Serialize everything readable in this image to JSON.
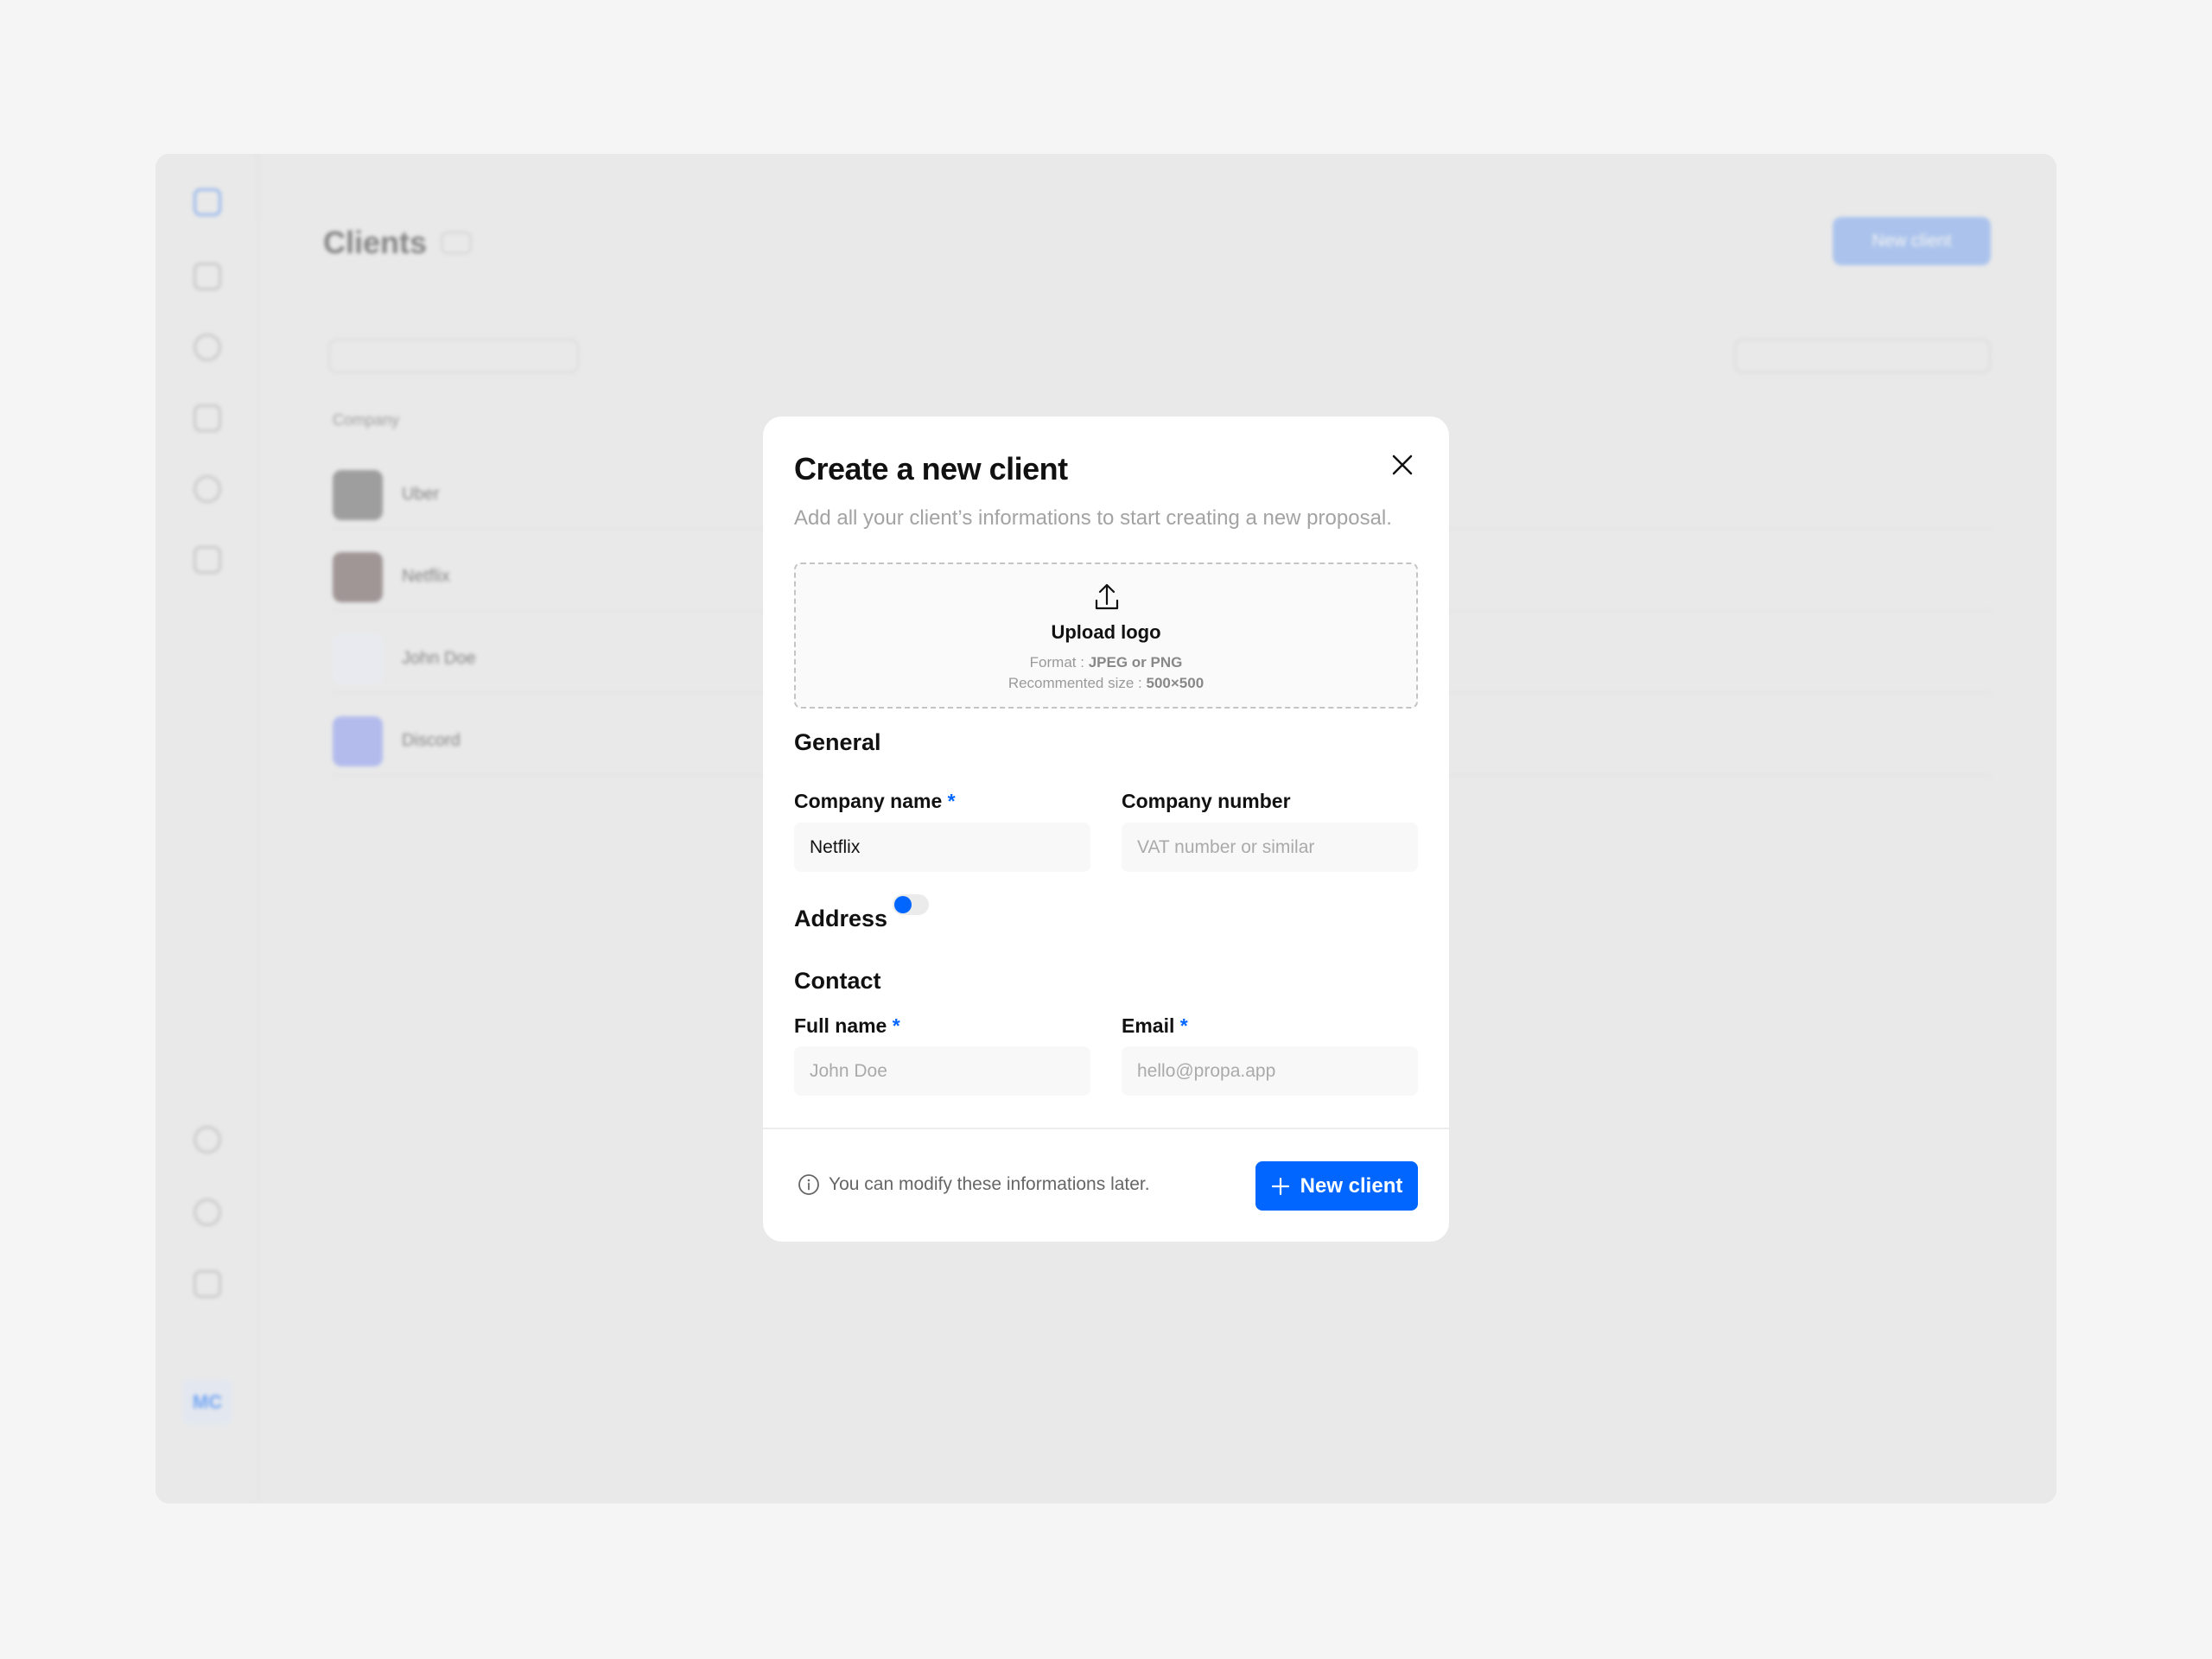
{
  "background": {
    "page_title": "Clients",
    "primary_button": "New client",
    "table_header": "Company",
    "rows": [
      {
        "name": "Uber",
        "avatar_color": "#555555"
      },
      {
        "name": "Netflix",
        "avatar_color": "#5a4545"
      },
      {
        "name": "John Doe",
        "avatar_color": "#e8ecf8"
      },
      {
        "name": "Discord",
        "avatar_color": "#7d8ff0"
      }
    ],
    "user_initials": "MC"
  },
  "modal": {
    "title": "Create a new client",
    "subtitle": "Add all your client’s informations to start creating a new proposal.",
    "upload": {
      "label": "Upload logo",
      "format_prefix": "Format : ",
      "format_value": "JPEG or PNG",
      "size_prefix": "Recommented size : ",
      "size_value": "500×500",
      "icon": "upload-icon"
    },
    "general": {
      "heading": "General",
      "company_name": {
        "label": "Company name",
        "required": "*",
        "value": "Netflix"
      },
      "company_number": {
        "label": "Company number",
        "placeholder": "VAT number or similar"
      }
    },
    "address": {
      "heading": "Address",
      "toggle_on": false
    },
    "contact": {
      "heading": "Contact",
      "full_name": {
        "label": "Full name",
        "required": "*",
        "placeholder": "John Doe"
      },
      "email": {
        "label": "Email",
        "required": "*",
        "placeholder": "hello@propa.app"
      }
    },
    "footer": {
      "info": "You can modify these informations later.",
      "submit": "New client"
    }
  },
  "colors": {
    "accent": "#0066ff",
    "background": "#f5f5f5"
  }
}
